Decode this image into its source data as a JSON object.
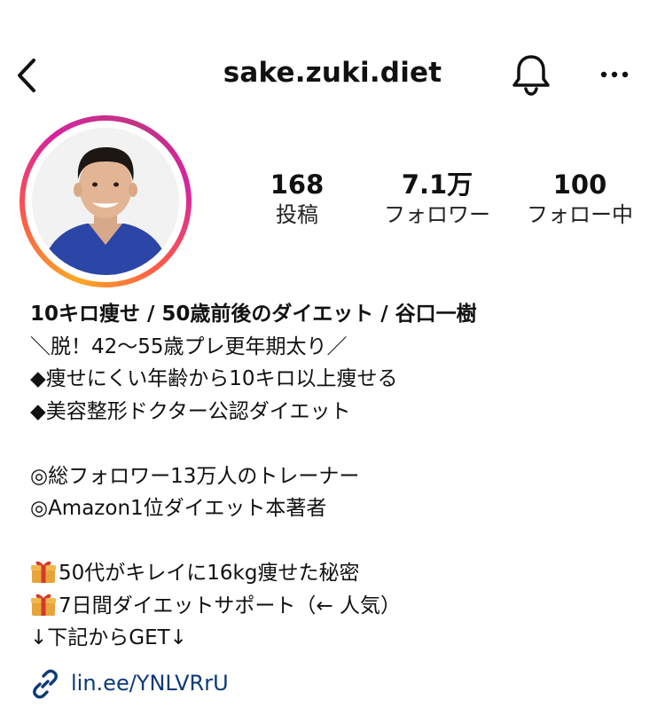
{
  "header": {
    "username": "sake.zuki.diet",
    "back_icon": "chevron-left-icon",
    "notification_icon": "bell-icon",
    "more_icon": "more-horizontal-icon"
  },
  "profile": {
    "avatar_icon": "profile-photo",
    "ring_colors": [
      "#f9a825",
      "#fd5949",
      "#d6249f",
      "#c13584"
    ]
  },
  "stats": [
    {
      "value": "168",
      "label": "投稿"
    },
    {
      "value": "7.1万",
      "label": "フォロワー"
    },
    {
      "value": "100",
      "label": "フォロー中"
    }
  ],
  "bio": {
    "name": "10キロ痩せ / 50歳前後のダイエット / 谷口一樹",
    "lines": [
      "＼脱！42～55歳プレ更年期太り／",
      "◆痩せにくい年齢から10キロ以上痩せる",
      "◆美容整形ドクター公認ダイエット",
      "",
      "◎総フォロワー13万人のトレーナー",
      "◎Amazon1位ダイエット本著者",
      "",
      "50代がキレイに16kg痩せた秘密",
      "7日間ダイエットサポート（← 人気）",
      "↓下記からGET↓"
    ]
  },
  "link": {
    "text": "lin.ee/YNLVRrU",
    "icon": "link-icon",
    "color": "#0c3a78"
  }
}
